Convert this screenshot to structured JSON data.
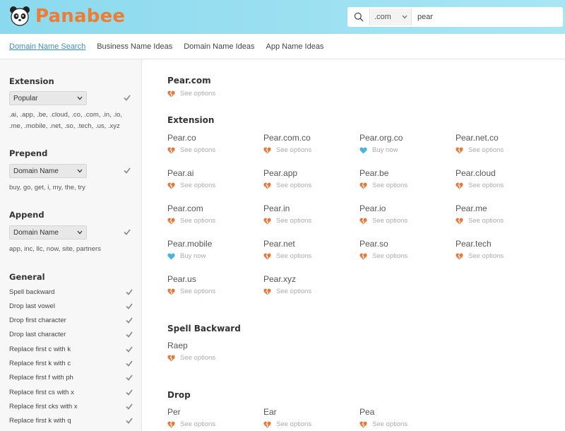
{
  "header": {
    "brand": "Panabee",
    "tld": ".com",
    "query": "pear"
  },
  "nav": [
    "Domain Name Search",
    "Business Name Ideas",
    "Domain Name Ideas",
    "App Name Ideas"
  ],
  "sidebar": {
    "extension": {
      "title": "Extension",
      "select": "Popular",
      "desc": ".ai, .app, .be, .cloud, .co, .com, .in, .io, .me, .mobile, .net, .so, .tech, .us, .xyz"
    },
    "prepend": {
      "title": "Prepend",
      "select": "Domain Name",
      "desc": "buy, go, get, i, my, the, try"
    },
    "append": {
      "title": "Append",
      "select": "Domain Name",
      "desc": "app, inc, llc, now, site, partners"
    },
    "general": {
      "title": "General",
      "items": [
        "Spell backward",
        "Drop last vowel",
        "Drop first character",
        "Drop last character",
        "Replace first c with k",
        "Replace first k with c",
        "Replace first f with ph",
        "Replace first cs with x",
        "Replace first cks with x",
        "Replace first k with q"
      ]
    }
  },
  "main": {
    "top": {
      "title": "Pear.com",
      "action": "See options",
      "status": "taken"
    },
    "extension": {
      "title": "Extension",
      "items": [
        {
          "name": "Pear.co",
          "action": "See options",
          "status": "taken"
        },
        {
          "name": "Pear.com.co",
          "action": "See options",
          "status": "taken"
        },
        {
          "name": "Pear.org.co",
          "action": "Buy now",
          "status": "available"
        },
        {
          "name": "Pear.net.co",
          "action": "See options",
          "status": "taken"
        },
        {
          "name": "Pear.ai",
          "action": "See options",
          "status": "taken"
        },
        {
          "name": "Pear.app",
          "action": "See options",
          "status": "taken"
        },
        {
          "name": "Pear.be",
          "action": "See options",
          "status": "taken"
        },
        {
          "name": "Pear.cloud",
          "action": "See options",
          "status": "taken"
        },
        {
          "name": "Pear.com",
          "action": "See options",
          "status": "taken"
        },
        {
          "name": "Pear.in",
          "action": "See options",
          "status": "taken"
        },
        {
          "name": "Pear.io",
          "action": "See options",
          "status": "taken"
        },
        {
          "name": "Pear.me",
          "action": "See options",
          "status": "taken"
        },
        {
          "name": "Pear.mobile",
          "action": "Buy now",
          "status": "available"
        },
        {
          "name": "Pear.net",
          "action": "See options",
          "status": "taken"
        },
        {
          "name": "Pear.so",
          "action": "See options",
          "status": "taken"
        },
        {
          "name": "Pear.tech",
          "action": "See options",
          "status": "taken"
        },
        {
          "name": "Pear.us",
          "action": "See options",
          "status": "taken"
        },
        {
          "name": "Pear.xyz",
          "action": "See options",
          "status": "taken"
        }
      ]
    },
    "spell_backward": {
      "title": "Spell Backward",
      "items": [
        {
          "name": "Raep",
          "action": "See options",
          "status": "taken"
        }
      ]
    },
    "drop": {
      "title": "Drop",
      "items": [
        {
          "name": "Per",
          "action": "See options",
          "status": "taken"
        },
        {
          "name": "Ear",
          "action": "See options",
          "status": "taken"
        },
        {
          "name": "Pea",
          "action": "See options",
          "status": "taken"
        }
      ]
    }
  },
  "colors": {
    "brand": "#ee7d33",
    "header_bg": "#9fe1f2",
    "link_active": "#3a8fc4",
    "taken_heart": "#e8773a",
    "available_heart": "#49b3e0",
    "check": "#888888"
  },
  "icons": {
    "logo": "panda-icon",
    "search": "search-icon",
    "chevron": "chevron-down-icon",
    "check": "check-icon",
    "taken": "broken-heart-icon",
    "available": "heart-icon"
  }
}
